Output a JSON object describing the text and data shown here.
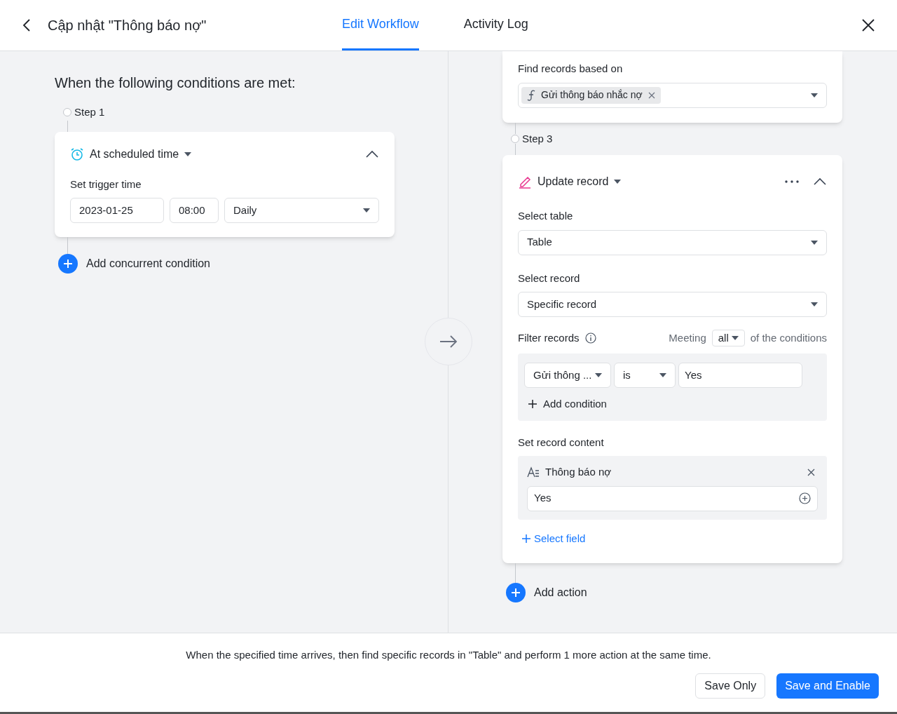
{
  "header": {
    "title": "Cập nhật \"Thông báo nợ\"",
    "tabs": [
      {
        "label": "Edit Workflow",
        "selected": true
      },
      {
        "label": "Activity Log",
        "selected": false
      }
    ]
  },
  "left": {
    "heading": "When the following conditions are met:",
    "step_label": "Step 1",
    "trigger": {
      "type": "At scheduled time",
      "label": "Set trigger time",
      "date": "2023-01-25",
      "time": "08:00",
      "frequency": "Daily"
    },
    "add_condition": "Add concurrent condition"
  },
  "right": {
    "find_card": {
      "label": "Find records based on",
      "chip": "Gửi thông báo nhắc nợ"
    },
    "step_label": "Step 3",
    "action": {
      "type": "Update record",
      "select_table_label": "Select table",
      "table": "Table",
      "select_record_label": "Select record",
      "record": "Specific record",
      "filter": {
        "label": "Filter records",
        "meeting": "Meeting",
        "mode": "all",
        "suffix": "of the conditions",
        "conditions": [
          {
            "field": "Gửi thông ...",
            "operator": "is",
            "value": "Yes"
          }
        ],
        "add_condition": "Add condition"
      },
      "content_label": "Set record content",
      "fields": [
        {
          "name": "Thông báo nợ",
          "value": "Yes"
        }
      ],
      "select_field": "Select field"
    },
    "add_action": "Add action"
  },
  "footer": {
    "summary": "When the specified time arrives, then find specific records in \"Table\" and perform 1 more action at the same time.",
    "buttons": [
      {
        "label": "Save Only",
        "kind": "secondary"
      },
      {
        "label": "Save and Enable",
        "kind": "primary"
      }
    ]
  }
}
